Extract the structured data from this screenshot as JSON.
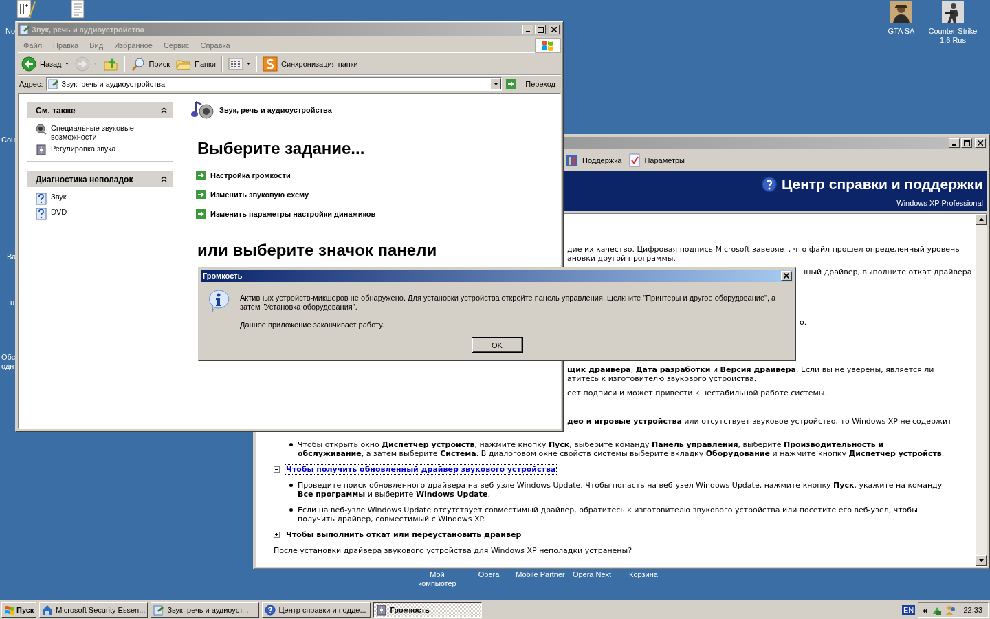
{
  "desktop": {
    "top_icons": [
      {
        "kind": "editor"
      },
      {
        "kind": "document"
      }
    ],
    "edge_labels": [
      {
        "lines": [
          "No"
        ]
      },
      {
        "lines": [
          "Cou"
        ]
      },
      {
        "lines": [
          "Ва"
        ]
      },
      {
        "lines": [
          "u"
        ]
      },
      {
        "lines": [
          "Обс",
          "одн"
        ]
      }
    ],
    "right_icons": [
      {
        "kind": "figure",
        "lines": [
          "GTA SA"
        ]
      },
      {
        "kind": "soldier",
        "lines": [
          "Counter-Strike",
          "1.6 Rus"
        ]
      }
    ],
    "bottom_labels": [
      {
        "lines": [
          "Мой",
          "компьютер"
        ]
      },
      {
        "lines": [
          "Opera"
        ]
      },
      {
        "lines": [
          "Mobile Partner"
        ]
      },
      {
        "lines": [
          "Opera Next"
        ]
      },
      {
        "lines": [
          "Корзина"
        ]
      }
    ]
  },
  "help_window": {
    "active": false,
    "toolbar": [
      {
        "kind": "support",
        "label": "Поддержка"
      },
      {
        "kind": "options",
        "label": "Параметры"
      }
    ],
    "banner_title": "Центр справки и поддержки",
    "banner_subtitle": "Windows XP Professional",
    "fragments": [
      {
        "lines": [
          "дие их качество. Цифровая подпись Microsoft заверяет, что файл прошел определенный уровень",
          "ановки другой программы."
        ]
      },
      {
        "lines": [
          "нный драйвер, выполните откат драйвера"
        ]
      },
      {
        "lines": [
          "о."
        ]
      },
      {
        "lines": [
          "**щик драйвера**, **Дата разработки** и **Версия драйвера**. Если вы не уверены, является ли",
          "атитесь к изготовителю звукового устройства."
        ]
      },
      {
        "lines": [
          "еет подписи и может привести к нестабильной работе системы."
        ]
      },
      {
        "lines": [
          "**део и игровые устройства** или отсутствует звуковое устройство, то Windows XP не содержит"
        ]
      }
    ],
    "items": [
      {
        "kind": "bullet",
        "text": "Чтобы открыть окно **Диспетчер устройств**, нажмите кнопку **Пуск**, выберите команду **Панель управления**, выберите **Производительность и обслуживание**, а затем выберите **Система**. В диалоговом окне свойств системы выберите вкладку **Оборудование** и нажмите кнопку **Диспетчер устройств**."
      },
      {
        "kind": "section",
        "expanded": true,
        "selected": true,
        "text": "**Чтобы получить обновленный драйвер звукового устройства**"
      },
      {
        "kind": "bullet",
        "text": "Проведите поиск обновленного драйвера на веб-узле Windows Update. Чтобы попасть на веб-узел Windows Update, нажмите кнопку **Пуск**, укажите на команду **Все программы** и выберите **Windows Update**."
      },
      {
        "kind": "bullet",
        "text": "Если на веб-узле Windows Update отсутствует совместимый драйвер, обратитесь к изготовителю звукового устройства или посетите его веб-узел, чтобы получить драйвер, совместимый с Windows XP."
      },
      {
        "kind": "section",
        "expanded": false,
        "selected": false,
        "text": "**Чтобы выполнить откат или переустановить драйвер**"
      },
      {
        "kind": "paragraph",
        "text": "После установки драйвера звукового устройства для Windows XP неполадки устранены?"
      }
    ]
  },
  "explorer": {
    "title": "Звук, речь и аудиоустройства",
    "active": false,
    "menu": [
      "Файл",
      "Правка",
      "Вид",
      "Избранное",
      "Сервис",
      "Справка"
    ],
    "toolbar": [
      {
        "kind": "back",
        "label": "Назад",
        "disabled": false
      },
      {
        "kind": "forward",
        "disabled": true
      },
      {
        "kind": "up",
        "disabled": false
      },
      {
        "kind": "search",
        "label": "Поиск",
        "disabled": false
      },
      {
        "kind": "folders",
        "label": "Папки",
        "disabled": false
      },
      {
        "kind": "views",
        "disabled": false
      },
      {
        "kind": "sync",
        "label": "Синхронизация папки",
        "disabled": false
      }
    ],
    "address": {
      "label": "Адрес:",
      "value": "Звук, речь и аудиоустройства",
      "go": "Переход"
    },
    "panels": [
      {
        "title": "См. также",
        "expanded": true,
        "items": [
          {
            "kind": "speaker",
            "label": "Специальные звуковые возможности"
          },
          {
            "kind": "volume",
            "label": "Регулировка звука"
          }
        ]
      },
      {
        "title": "Диагностика неполадок",
        "expanded": true,
        "items": [
          {
            "kind": "help",
            "label": "Звук"
          },
          {
            "kind": "help",
            "label": "DVD"
          }
        ]
      }
    ],
    "category": "Звук, речь и аудиоустройства",
    "heading": "Выберите задание...",
    "tasks": [
      "Настройка громкости",
      "Изменить звуковую схему",
      "Изменить параметры настройки динамиков"
    ],
    "heading2": "или выберите значок панели"
  },
  "dialog": {
    "title": "Громкость",
    "active": true,
    "message": "Активных устройств-микшеров не обнаружено. Для установки устройства откройте панель управления, щелкните \"Принтеры и другое оборудование\", а затем \"Установка оборудования\".",
    "note": "Данное приложение заканчивает работу.",
    "button": "OK"
  },
  "taskbar": {
    "start": "Пуск",
    "tasks": [
      {
        "kind": "shield",
        "label": "Microsoft Security Essen...",
        "selected": false
      },
      {
        "kind": "control",
        "label": "Звук, речь и аудиоуст...",
        "selected": false
      },
      {
        "kind": "help",
        "label": "Центр справки и подде...",
        "selected": false
      },
      {
        "kind": "volume",
        "label": "Громкость",
        "selected": true
      }
    ],
    "language": "EN",
    "tray_toggle": "«",
    "clock": "22:33"
  }
}
